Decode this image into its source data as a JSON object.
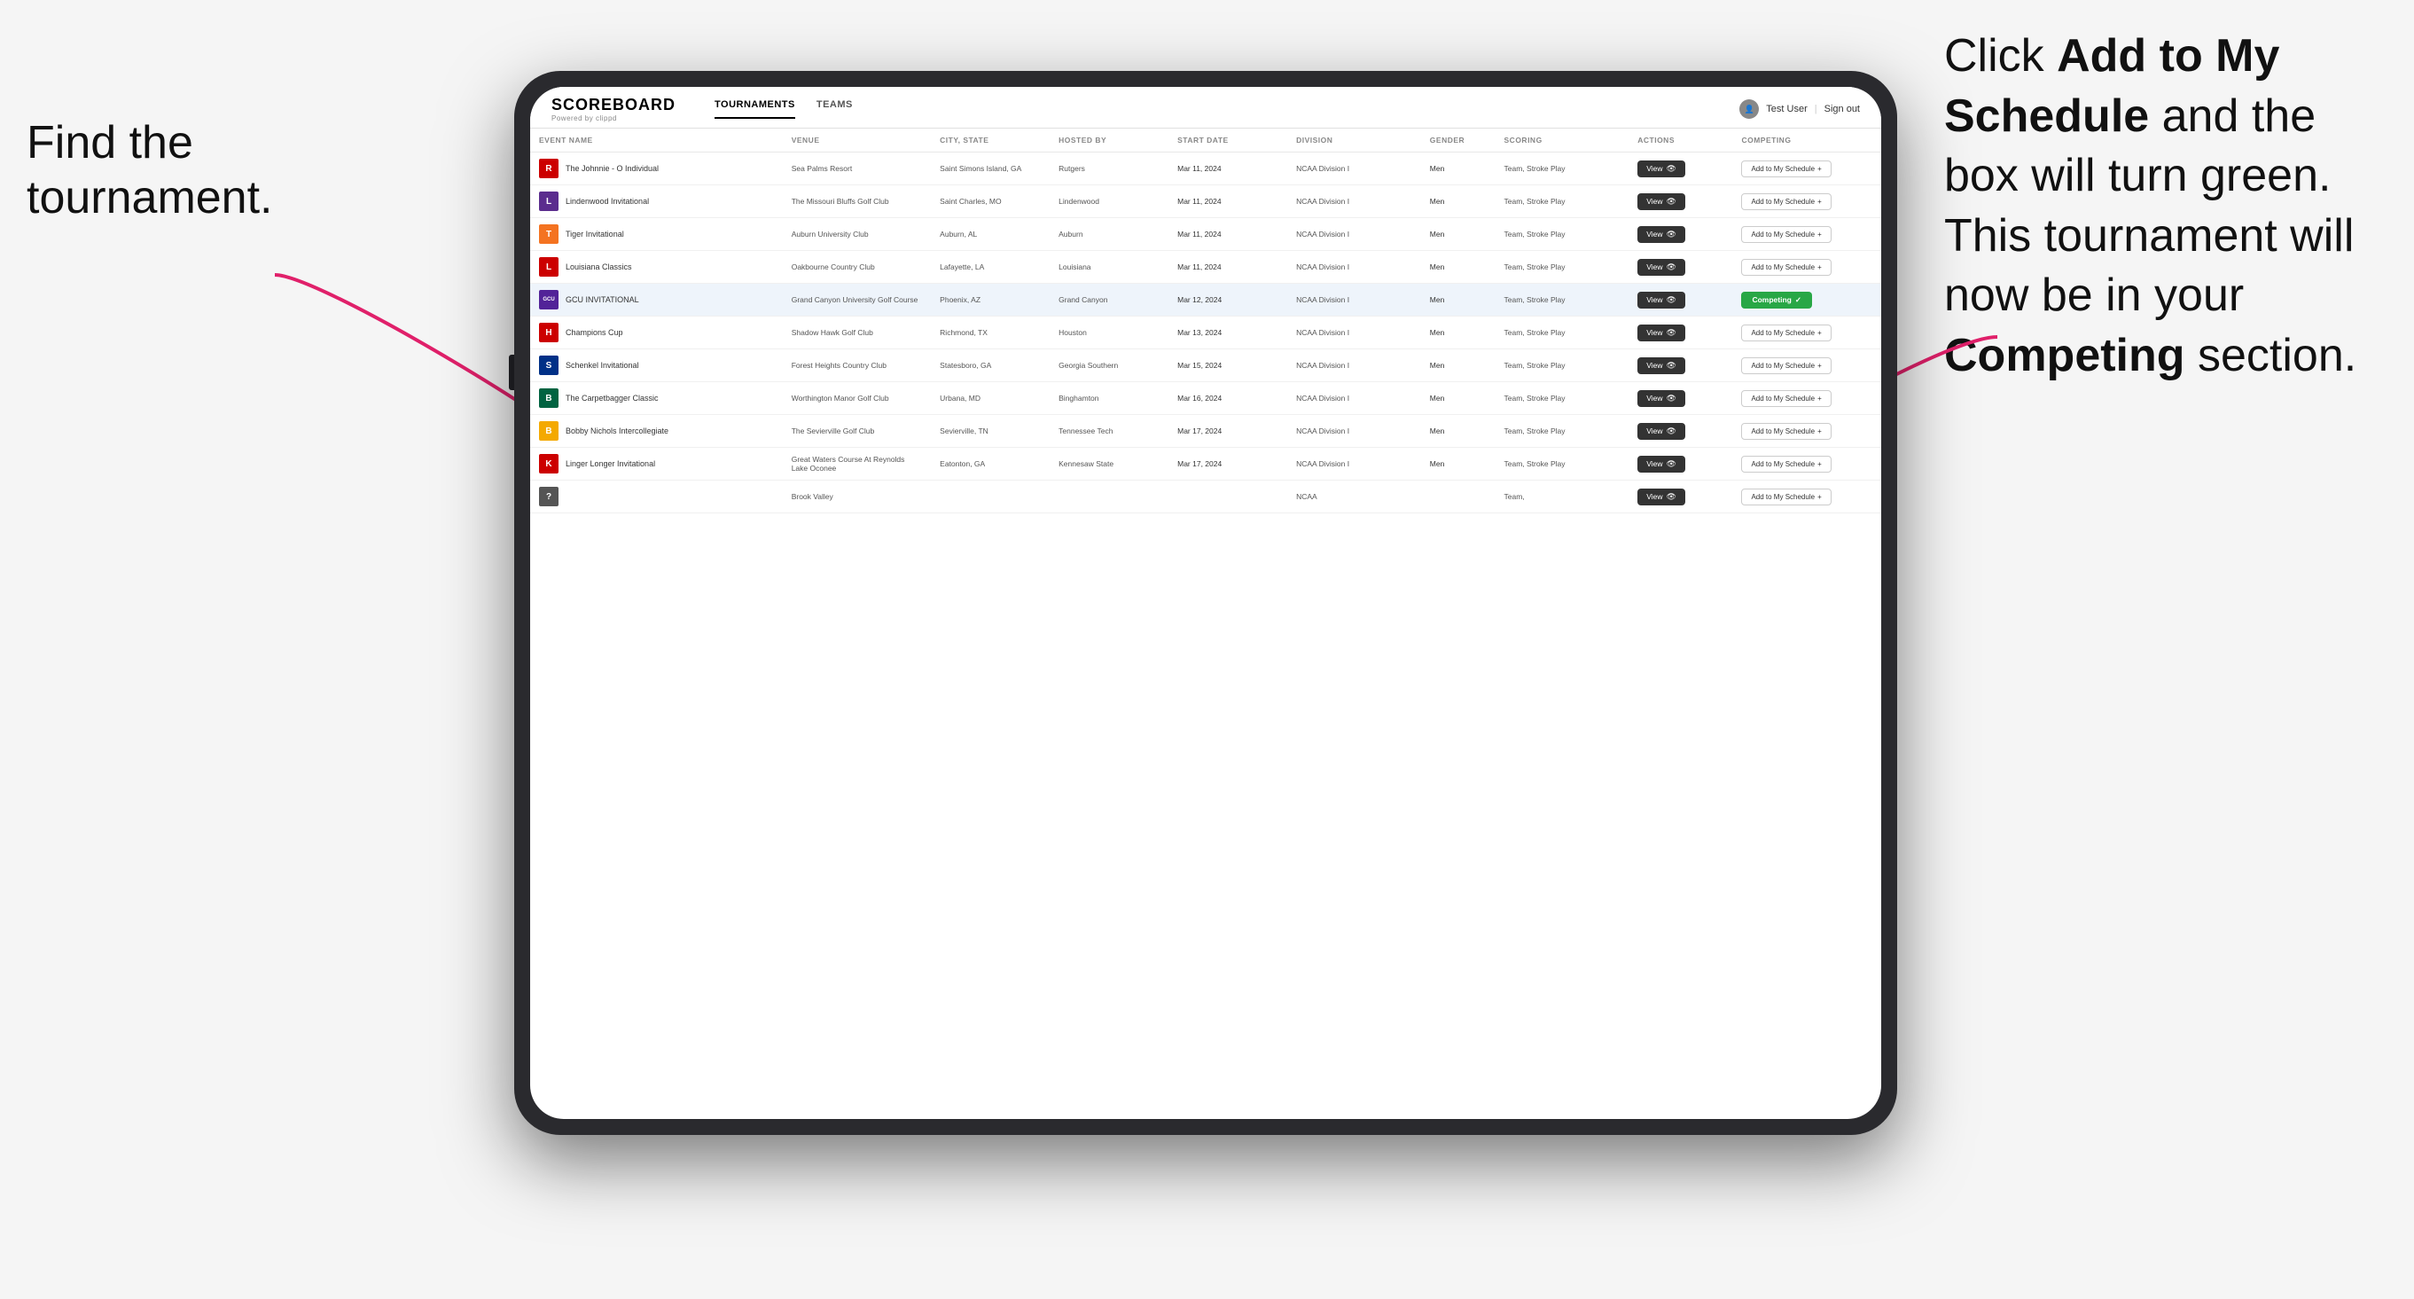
{
  "annotations": {
    "left_title": "Find the\ntournament.",
    "right_text_pre": "Click ",
    "right_bold1": "Add to My\nSchedule",
    "right_text_mid": " and the\nbox will turn green.\nThis tournament\nwill now be in\nyour ",
    "right_bold2": "Competing",
    "right_text_end": "\nsection."
  },
  "header": {
    "logo": "SCOREBOARD",
    "logo_sub": "Powered by clippd",
    "nav_tabs": [
      "TOURNAMENTS",
      "TEAMS"
    ],
    "active_tab": "TOURNAMENTS",
    "user_name": "Test User",
    "sign_out": "Sign out"
  },
  "table": {
    "columns": [
      "EVENT NAME",
      "VENUE",
      "CITY, STATE",
      "HOSTED BY",
      "START DATE",
      "DIVISION",
      "GENDER",
      "SCORING",
      "ACTIONS",
      "COMPETING"
    ],
    "rows": [
      {
        "logo_color": "#cc0000",
        "logo_text": "R",
        "event": "The Johnnie - O Individual",
        "venue": "Sea Palms Resort",
        "city": "Saint Simons Island, GA",
        "hosted": "Rutgers",
        "start": "Mar 11, 2024",
        "division": "NCAA Division I",
        "gender": "Men",
        "scoring": "Team, Stroke Play",
        "action": "View",
        "competing": "Add to My Schedule +",
        "competing_type": "add"
      },
      {
        "logo_color": "#5b2d8e",
        "logo_text": "L",
        "event": "Lindenwood Invitational",
        "venue": "The Missouri Bluffs Golf Club",
        "city": "Saint Charles, MO",
        "hosted": "Lindenwood",
        "start": "Mar 11, 2024",
        "division": "NCAA Division I",
        "gender": "Men",
        "scoring": "Team, Stroke Play",
        "action": "View",
        "competing": "Add to My Schedule +",
        "competing_type": "add"
      },
      {
        "logo_color": "#f47321",
        "logo_text": "T",
        "event": "Tiger Invitational",
        "venue": "Auburn University Club",
        "city": "Auburn, AL",
        "hosted": "Auburn",
        "start": "Mar 11, 2024",
        "division": "NCAA Division I",
        "gender": "Men",
        "scoring": "Team, Stroke Play",
        "action": "View",
        "competing": "Add to My Schedule +",
        "competing_type": "add"
      },
      {
        "logo_color": "#cc0000",
        "logo_text": "L",
        "event": "Louisiana Classics",
        "venue": "Oakbourne Country Club",
        "city": "Lafayette, LA",
        "hosted": "Louisiana",
        "start": "Mar 11, 2024",
        "division": "NCAA Division I",
        "gender": "Men",
        "scoring": "Team, Stroke Play",
        "action": "View",
        "competing": "Add to My Schedule +",
        "competing_type": "add"
      },
      {
        "logo_color": "#522398",
        "logo_text": "GCU",
        "event": "GCU INVITATIONAL",
        "venue": "Grand Canyon University Golf Course",
        "city": "Phoenix, AZ",
        "hosted": "Grand Canyon",
        "start": "Mar 12, 2024",
        "division": "NCAA Division I",
        "gender": "Men",
        "scoring": "Team, Stroke Play",
        "action": "View",
        "competing": "Competing ✓",
        "competing_type": "competing",
        "highlighted": true
      },
      {
        "logo_color": "#cc0000",
        "logo_text": "H",
        "event": "Champions Cup",
        "venue": "Shadow Hawk Golf Club",
        "city": "Richmond, TX",
        "hosted": "Houston",
        "start": "Mar 13, 2024",
        "division": "NCAA Division I",
        "gender": "Men",
        "scoring": "Team, Stroke Play",
        "action": "View",
        "competing": "Add to My Schedule +",
        "competing_type": "add"
      },
      {
        "logo_color": "#003087",
        "logo_text": "S",
        "event": "Schenkel Invitational",
        "venue": "Forest Heights Country Club",
        "city": "Statesboro, GA",
        "hosted": "Georgia Southern",
        "start": "Mar 15, 2024",
        "division": "NCAA Division I",
        "gender": "Men",
        "scoring": "Team, Stroke Play",
        "action": "View",
        "competing": "Add to My Schedule +",
        "competing_type": "add"
      },
      {
        "logo_color": "#006341",
        "logo_text": "B",
        "event": "The Carpetbagger Classic",
        "venue": "Worthington Manor Golf Club",
        "city": "Urbana, MD",
        "hosted": "Binghamton",
        "start": "Mar 16, 2024",
        "division": "NCAA Division I",
        "gender": "Men",
        "scoring": "Team, Stroke Play",
        "action": "View",
        "competing": "Add to My Schedule +",
        "competing_type": "add"
      },
      {
        "logo_color": "#f4a900",
        "logo_text": "B",
        "event": "Bobby Nichols Intercollegiate",
        "venue": "The Sevierville Golf Club",
        "city": "Sevierville, TN",
        "hosted": "Tennessee Tech",
        "start": "Mar 17, 2024",
        "division": "NCAA Division I",
        "gender": "Men",
        "scoring": "Team, Stroke Play",
        "action": "View",
        "competing": "Add to My Schedule +",
        "competing_type": "add"
      },
      {
        "logo_color": "#cc0000",
        "logo_text": "K",
        "event": "Linger Longer Invitational",
        "venue": "Great Waters Course At Reynolds Lake Oconee",
        "city": "Eatonton, GA",
        "hosted": "Kennesaw State",
        "start": "Mar 17, 2024",
        "division": "NCAA Division I",
        "gender": "Men",
        "scoring": "Team, Stroke Play",
        "action": "View",
        "competing": "Add to My Schedule +",
        "competing_type": "add"
      },
      {
        "logo_color": "#555",
        "logo_text": "?",
        "event": "",
        "venue": "Brook Valley",
        "city": "",
        "hosted": "",
        "start": "",
        "division": "NCAA",
        "gender": "",
        "scoring": "Team,",
        "action": "View",
        "competing": "Add to My Schedule +",
        "competing_type": "add"
      }
    ]
  }
}
